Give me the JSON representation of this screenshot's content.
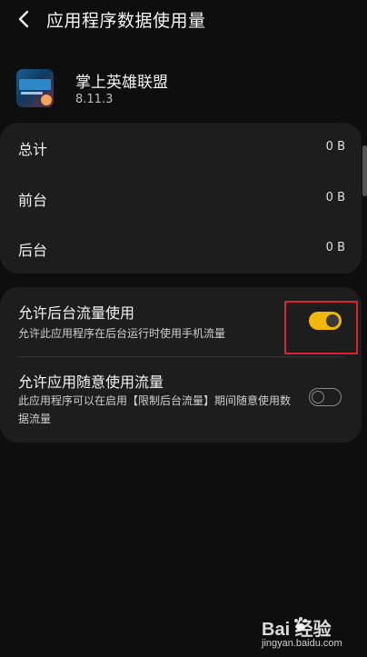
{
  "header": {
    "title": "应用程序数据使用量",
    "back_icon": "arrow-left-icon"
  },
  "app": {
    "name": "掌上英雄联盟",
    "version": "8.11.3",
    "icon": "app-logo-icon",
    "icon_text": "英雄联盟"
  },
  "usage": {
    "rows": [
      {
        "label": "总计",
        "value": "0 B"
      },
      {
        "label": "前台",
        "value": "0 B"
      },
      {
        "label": "后台",
        "value": "0 B"
      }
    ]
  },
  "toggles": [
    {
      "title": "允许后台流量使用",
      "description": "允许此应用程序在后台运行时使用手机流量",
      "state": "on"
    },
    {
      "title": "允许应用随意使用流量",
      "description": "此应用程序可以在启用【限制后台流量】期间随意使用数据流量",
      "state": "off"
    }
  ],
  "colors": {
    "background": "#0e0e0e",
    "card": "#1d1d1d",
    "accent": "#f2b705",
    "highlight": "#d9232e"
  },
  "watermark": {
    "brand": "Bai  经验",
    "url": "jingyan.baidu.com"
  }
}
